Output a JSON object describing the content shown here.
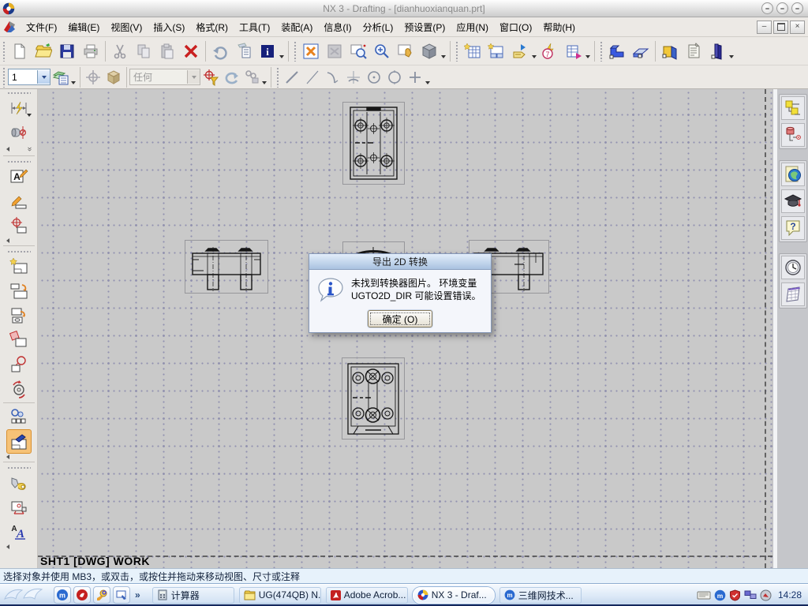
{
  "window": {
    "title": "NX 3 - Drafting - [dianhuoxianquan.prt]"
  },
  "glyphs": {
    "minimize": "–",
    "close": "×",
    "double_chevron": "»"
  },
  "menu": {
    "items": [
      "文件(F)",
      "编辑(E)",
      "视图(V)",
      "插入(S)",
      "格式(R)",
      "工具(T)",
      "装配(A)",
      "信息(I)",
      "分析(L)",
      "预设置(P)",
      "应用(N)",
      "窗口(O)",
      "帮助(H)"
    ]
  },
  "toolbars": {
    "layer_value": "1",
    "selection_scope": "任何"
  },
  "canvas": {
    "sheet_label": "SHT1 [DWG] WORK"
  },
  "dialog": {
    "title": "导出 2D 转换",
    "message_line1": "未找到转换器图片。 环境变量",
    "message_line2": "UGTO2D_DIR 可能设置错误。",
    "ok_label": "确定 (O)"
  },
  "status_bar": {
    "prompt": "选择对象并使用 MB3，或双击，或按住并拖动来移动视图、尺寸或注释"
  },
  "taskbar": {
    "quick_launch_more": "»",
    "tasks": [
      "计算器",
      "UG(474QB) N...",
      "Adobe Acrob...",
      "NX 3 - Draf...",
      "三维网技术..."
    ],
    "clock": "14:28"
  },
  "colors": {
    "active_tool_highlight": "#f6c277",
    "dialog_titlebar": "#a9c2e0",
    "canvas_background": "#c9c9c9",
    "grid_dot": "#9191b0",
    "taskbar_bottom_edge": "#16295e",
    "delete_red": "#c92020"
  }
}
